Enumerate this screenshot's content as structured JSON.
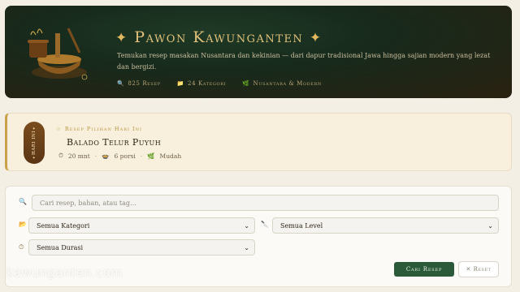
{
  "hero": {
    "title": "Pawon Kawunganten",
    "star_left": "✦",
    "star_right": "✦",
    "description": "Temukan resep masakan Nusantara dan kekinian — dari dapur tradisional Jawa hingga sajian modern yang lezat dan bergizi.",
    "stats": [
      {
        "icon": "magnifier-icon",
        "glyph": "🔍",
        "label": "825 Resep"
      },
      {
        "icon": "folder-icon",
        "glyph": "📁",
        "label": "24 Kategori"
      },
      {
        "icon": "leaf-icon",
        "glyph": "🌿",
        "label": "Nusantara & Modern"
      }
    ]
  },
  "featured": {
    "badge": "HARI INI",
    "kicker": "Resep Pilihan Hari Ini",
    "title": "Balado Telur Puyuh",
    "time": "20 mnt",
    "portions": "6 porsi",
    "level": "Mudah"
  },
  "filters": {
    "search_placeholder": "Cari resep, bahan, atau tag...",
    "category_selected": "Semua Kategori",
    "level_selected": "Semua Level",
    "duration_selected": "Semua Durasi",
    "search_button": "Cari Resep",
    "reset_button": "✕ Reset"
  },
  "watermark": "kawunganten.com",
  "colors": {
    "accent_gold": "#e2c27a",
    "primary_green": "#2b5a3a",
    "hero_bg": "#172a1c",
    "featured_bg": "#f8f0dd"
  }
}
